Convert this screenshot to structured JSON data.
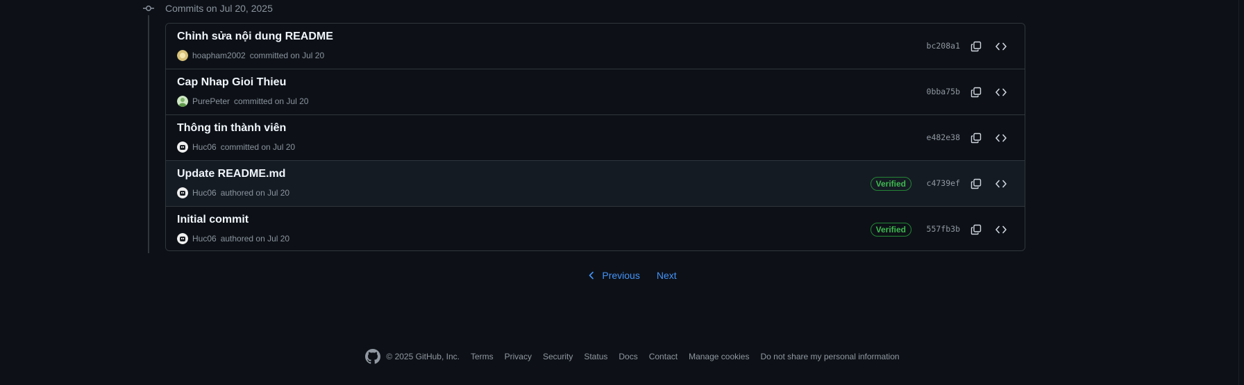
{
  "group": {
    "header": "Commits on Jul 20, 2025"
  },
  "commits": [
    {
      "title": "Chỉnh sửa nội dung README",
      "author": "hoapham2002",
      "action": "committed on Jul 20",
      "verified": "",
      "sha": "bc208a1",
      "avatar_color": "#d9c27a"
    },
    {
      "title": "Cap Nhap Gioi Thieu",
      "author": "PurePeter",
      "action": "committed on Jul 20",
      "verified": "",
      "sha": "0bba75b",
      "avatar_color": "#7fb36a"
    },
    {
      "title": "Thông tin thành viên",
      "author": "Huc06",
      "action": "committed on Jul 20",
      "verified": "",
      "sha": "e482e38",
      "avatar_color": "#f0f0f0"
    },
    {
      "title": "Update README.md",
      "author": "Huc06",
      "action": "authored on Jul 20",
      "verified": "Verified",
      "sha": "c4739ef",
      "avatar_color": "#f0f0f0"
    },
    {
      "title": "Initial commit",
      "author": "Huc06",
      "action": "authored on Jul 20",
      "verified": "Verified",
      "sha": "557fb3b",
      "avatar_color": "#f0f0f0"
    }
  ],
  "pagination": {
    "previous": "Previous",
    "next": "Next"
  },
  "footer": {
    "copyright": "© 2025 GitHub, Inc.",
    "links": [
      "Terms",
      "Privacy",
      "Security",
      "Status",
      "Docs",
      "Contact",
      "Manage cookies",
      "Do not share my personal information"
    ]
  },
  "colors": {
    "background": "#0d1117",
    "link": "#4493f8",
    "verified": "#3fb950",
    "border": "#30363d"
  }
}
